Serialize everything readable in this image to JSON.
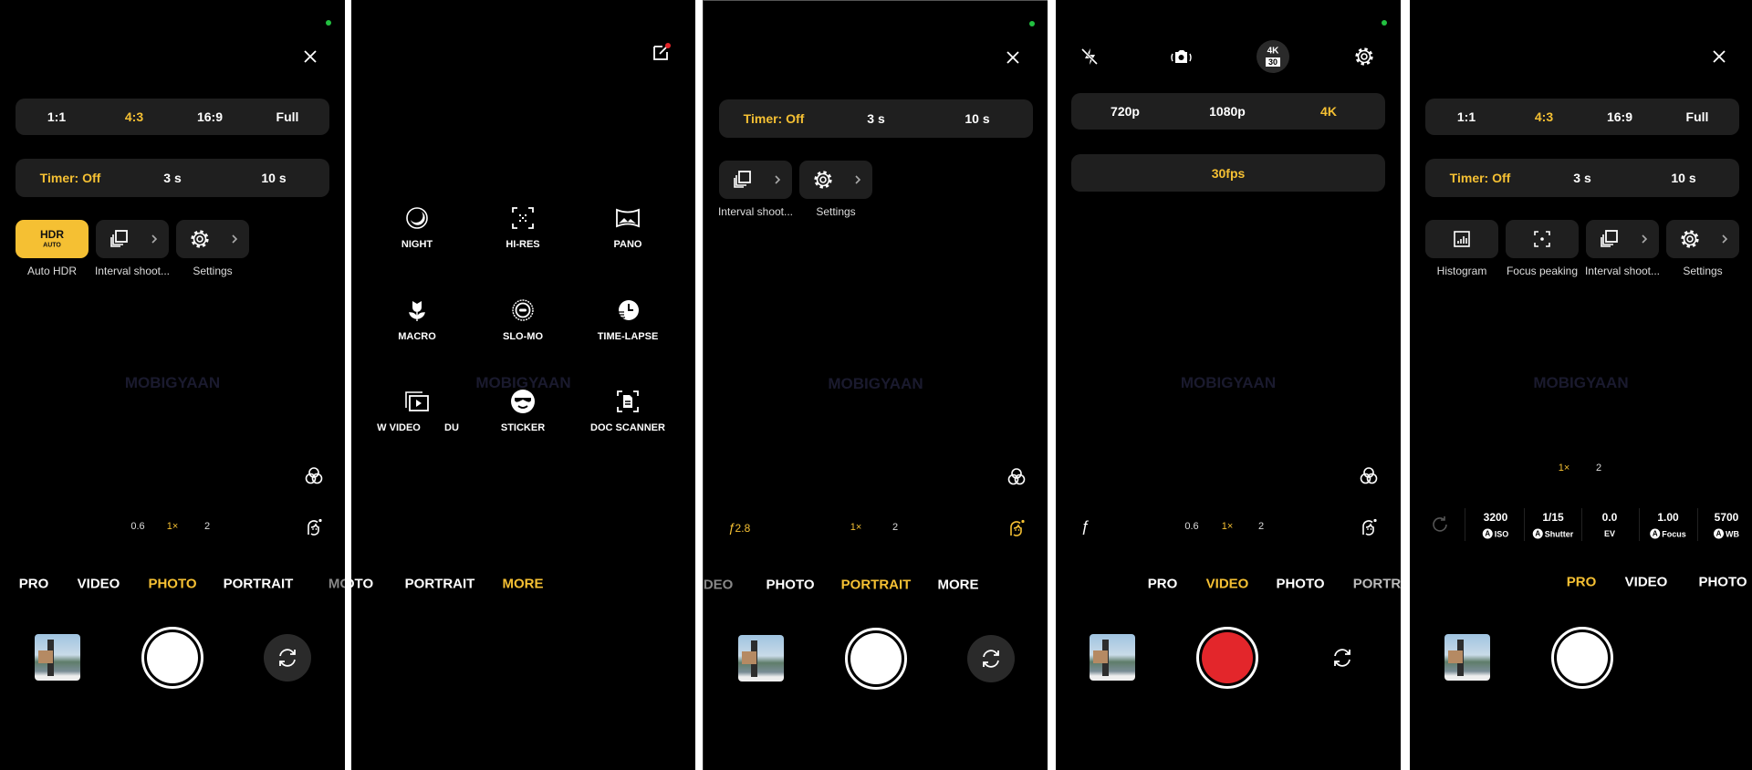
{
  "colors": {
    "accent": "#f5c033",
    "record": "#e3262b",
    "status_dot": "#22c040",
    "background": "#000000",
    "surface": "#1f1f1f"
  },
  "watermark": "MOBIGYAAN",
  "photo_panel": {
    "aspect_options": [
      "1:1",
      "4:3",
      "16:9",
      "Full"
    ],
    "aspect_selected": "4:3",
    "timer_options": [
      "Timer: Off",
      "3 s",
      "10 s"
    ],
    "timer_selected": "Timer: Off",
    "hdr_badge_top": "HDR",
    "hdr_badge_bottom": "AUTO",
    "tiles": [
      "Auto HDR",
      "Interval shoot...",
      "Settings"
    ],
    "zoom": [
      "0.6",
      "1×",
      "2"
    ],
    "zoom_selected": "1×",
    "modes": [
      "PRO",
      "VIDEO",
      "PHOTO",
      "PORTRAIT",
      "MO"
    ],
    "active_mode": "PHOTO"
  },
  "more_panel": {
    "grid": [
      {
        "label": "NIGHT",
        "icon": "night-icon"
      },
      {
        "label": "HI-RES",
        "icon": "hi-res-icon"
      },
      {
        "label": "PANO",
        "icon": "pano-icon"
      },
      {
        "label": "MACRO",
        "icon": "macro-icon"
      },
      {
        "label": "SLO-MO",
        "icon": "slo-mo-icon"
      },
      {
        "label": "TIME-LAPSE",
        "icon": "time-lapse-icon"
      },
      {
        "label": "W VIDEO",
        "icon": "video-icon"
      },
      {
        "label": "DU",
        "icon": ""
      },
      {
        "label": "STICKER",
        "icon": "sticker-icon"
      },
      {
        "label": "DOC SCANNER",
        "icon": "doc-scanner-icon"
      }
    ],
    "modes": [
      "OTO",
      "PORTRAIT",
      "MORE"
    ],
    "active_mode": "MORE"
  },
  "portrait_panel": {
    "timer_options": [
      "Timer: Off",
      "3 s",
      "10 s"
    ],
    "timer_selected": "Timer: Off",
    "tiles": [
      "Interval shoot...",
      "Settings"
    ],
    "aperture": "2.8",
    "aperture_symbol": "ƒ",
    "zoom": [
      "1×",
      "2"
    ],
    "zoom_selected": "1×",
    "modes": [
      "IDEO",
      "PHOTO",
      "PORTRAIT",
      "MORE"
    ],
    "active_mode": "PORTRAIT"
  },
  "video_panel": {
    "badge_top": "4K",
    "badge_bottom": "30",
    "resolution_options": [
      "720p",
      "1080p",
      "4K"
    ],
    "resolution_selected": "4K",
    "fps": "30fps",
    "aperture_symbol": "ƒ",
    "zoom": [
      "0.6",
      "1×",
      "2"
    ],
    "zoom_selected": "1×",
    "modes": [
      "PRO",
      "VIDEO",
      "PHOTO",
      "PORTR"
    ],
    "active_mode": "VIDEO"
  },
  "pro_panel": {
    "aspect_options": [
      "1:1",
      "4:3",
      "16:9",
      "Full"
    ],
    "aspect_selected": "4:3",
    "timer_options": [
      "Timer: Off",
      "3 s",
      "10 s"
    ],
    "timer_selected": "Timer: Off",
    "tiles": [
      "Histogram",
      "Focus peaking",
      "Interval shoot...",
      "Settings"
    ],
    "zoom": [
      "1×",
      "2"
    ],
    "zoom_selected": "1×",
    "auto_badge": "A",
    "params": [
      {
        "value": "3200",
        "label": "ISO",
        "auto": true
      },
      {
        "value": "1/15",
        "label": "Shutter",
        "auto": true
      },
      {
        "value": "0.0",
        "label": "EV",
        "auto": false
      },
      {
        "value": "1.00",
        "label": "Focus",
        "auto": true
      },
      {
        "value": "5700",
        "label": "WB",
        "auto": true
      }
    ],
    "modes": [
      "PRO",
      "VIDEO",
      "PHOTO"
    ],
    "active_mode": "PRO"
  }
}
